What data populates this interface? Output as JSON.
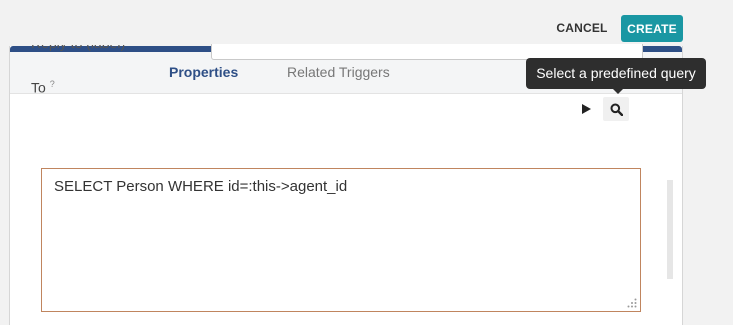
{
  "header": {
    "cancel_label": "CANCEL",
    "create_label": "CREATE",
    "create_color": "#1a97a3"
  },
  "tabs": [
    {
      "label": "Properties",
      "active": true
    },
    {
      "label": "Related Triggers",
      "active": false
    }
  ],
  "form": {
    "partial_label": "Reply to (label)",
    "to_label": "To",
    "to_help": "?",
    "query_value": "SELECT Person WHERE id=:this->agent_id",
    "tooltip": "Select a predefined query",
    "icons": [
      "play-icon",
      "search-icon",
      "resize-grip-icon"
    ]
  },
  "colors": {
    "accent": "#2e4f86",
    "tab_active": "#2e4f86",
    "query_border": "#c0855e"
  }
}
